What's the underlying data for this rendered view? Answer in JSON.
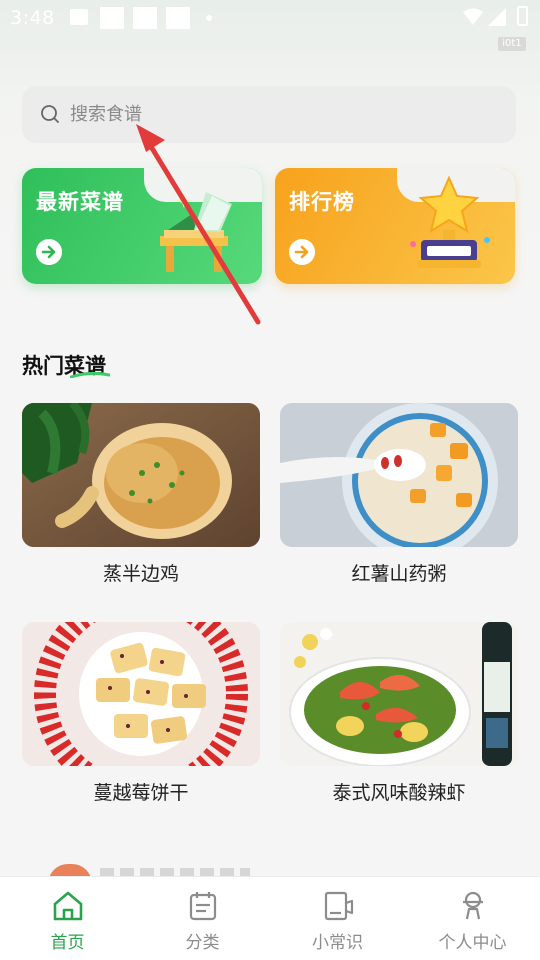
{
  "status_bar": {
    "time": "3:48",
    "carrier_tag": "i0t1"
  },
  "search": {
    "placeholder": "搜索食谱",
    "icon": "search-icon"
  },
  "feature_cards": [
    {
      "label": "最新菜谱",
      "color": "#34c45e",
      "icon": "book-icon"
    },
    {
      "label": "排行榜",
      "color": "#f8a923",
      "icon": "trophy-icon"
    }
  ],
  "hot_section": {
    "title": "热门菜谱",
    "accent": "#3ecb68"
  },
  "recipes": [
    {
      "name": "蒸半边鸡"
    },
    {
      "name": "红薯山药粥"
    },
    {
      "name": "蔓越莓饼干"
    },
    {
      "name": "泰式风味酸辣虾"
    }
  ],
  "bottom_nav": {
    "items": [
      {
        "label": "首页",
        "icon": "home-icon",
        "active": true
      },
      {
        "label": "分类",
        "icon": "category-icon",
        "active": false
      },
      {
        "label": "小常识",
        "icon": "tips-icon",
        "active": false
      },
      {
        "label": "个人中心",
        "icon": "profile-icon",
        "active": false
      }
    ],
    "active_color": "#2aa44c",
    "inactive_color": "#8c8c8c"
  },
  "annotation": {
    "color": "#e23b3b"
  }
}
